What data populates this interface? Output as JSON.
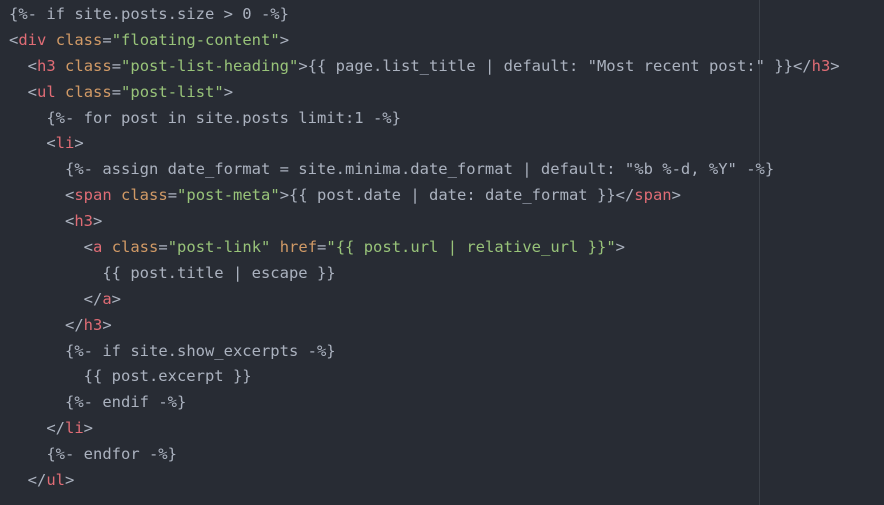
{
  "editor": {
    "colors": {
      "background": "#282c34",
      "plain": "#abb2bf",
      "tag": "#e06c75",
      "attribute": "#d19a66",
      "string": "#98c379",
      "ruler": "#3b4048"
    },
    "lines": [
      {
        "indent": 0,
        "tokens": [
          {
            "t": "plain",
            "v": "{%- if site.posts.size > 0 -%}"
          }
        ]
      },
      {
        "indent": 0,
        "tokens": [
          {
            "t": "plain",
            "v": "<"
          },
          {
            "t": "tag",
            "v": "div"
          },
          {
            "t": "plain",
            "v": " "
          },
          {
            "t": "attr",
            "v": "class"
          },
          {
            "t": "plain",
            "v": "="
          },
          {
            "t": "str",
            "v": "\"floating-content\""
          },
          {
            "t": "plain",
            "v": ">"
          }
        ]
      },
      {
        "indent": 2,
        "tokens": [
          {
            "t": "plain",
            "v": "<"
          },
          {
            "t": "tag",
            "v": "h3"
          },
          {
            "t": "plain",
            "v": " "
          },
          {
            "t": "attr",
            "v": "class"
          },
          {
            "t": "plain",
            "v": "="
          },
          {
            "t": "str",
            "v": "\"post-list-heading\""
          },
          {
            "t": "plain",
            "v": ">{{ page.list_title | default: \"Most recent post:\" }}</"
          },
          {
            "t": "tag",
            "v": "h3"
          },
          {
            "t": "plain",
            "v": ">"
          }
        ]
      },
      {
        "indent": 2,
        "tokens": [
          {
            "t": "plain",
            "v": "<"
          },
          {
            "t": "tag",
            "v": "ul"
          },
          {
            "t": "plain",
            "v": " "
          },
          {
            "t": "attr",
            "v": "class"
          },
          {
            "t": "plain",
            "v": "="
          },
          {
            "t": "str",
            "v": "\"post-list\""
          },
          {
            "t": "plain",
            "v": ">"
          }
        ]
      },
      {
        "indent": 4,
        "tokens": [
          {
            "t": "plain",
            "v": "{%- for post in site.posts limit:1 -%}"
          }
        ]
      },
      {
        "indent": 4,
        "tokens": [
          {
            "t": "plain",
            "v": "<"
          },
          {
            "t": "tag",
            "v": "li"
          },
          {
            "t": "plain",
            "v": ">"
          }
        ]
      },
      {
        "indent": 6,
        "tokens": [
          {
            "t": "plain",
            "v": "{%- assign date_format = site.minima.date_format | default: \"%b %-d, %Y\" -%}"
          }
        ]
      },
      {
        "indent": 6,
        "tokens": [
          {
            "t": "plain",
            "v": "<"
          },
          {
            "t": "tag",
            "v": "span"
          },
          {
            "t": "plain",
            "v": " "
          },
          {
            "t": "attr",
            "v": "class"
          },
          {
            "t": "plain",
            "v": "="
          },
          {
            "t": "str",
            "v": "\"post-meta\""
          },
          {
            "t": "plain",
            "v": ">{{ post.date | date: date_format }}</"
          },
          {
            "t": "tag",
            "v": "span"
          },
          {
            "t": "plain",
            "v": ">"
          }
        ]
      },
      {
        "indent": 6,
        "tokens": [
          {
            "t": "plain",
            "v": "<"
          },
          {
            "t": "tag",
            "v": "h3"
          },
          {
            "t": "plain",
            "v": ">"
          }
        ]
      },
      {
        "indent": 8,
        "tokens": [
          {
            "t": "plain",
            "v": "<"
          },
          {
            "t": "tag",
            "v": "a"
          },
          {
            "t": "plain",
            "v": " "
          },
          {
            "t": "attr",
            "v": "class"
          },
          {
            "t": "plain",
            "v": "="
          },
          {
            "t": "str",
            "v": "\"post-link\""
          },
          {
            "t": "plain",
            "v": " "
          },
          {
            "t": "attr",
            "v": "href"
          },
          {
            "t": "plain",
            "v": "="
          },
          {
            "t": "str",
            "v": "\"{{ post.url | relative_url }}\""
          },
          {
            "t": "plain",
            "v": ">"
          }
        ]
      },
      {
        "indent": 10,
        "tokens": [
          {
            "t": "plain",
            "v": "{{ post.title | escape }}"
          }
        ]
      },
      {
        "indent": 8,
        "tokens": [
          {
            "t": "plain",
            "v": "</"
          },
          {
            "t": "tag",
            "v": "a"
          },
          {
            "t": "plain",
            "v": ">"
          }
        ]
      },
      {
        "indent": 6,
        "tokens": [
          {
            "t": "plain",
            "v": "</"
          },
          {
            "t": "tag",
            "v": "h3"
          },
          {
            "t": "plain",
            "v": ">"
          }
        ]
      },
      {
        "indent": 6,
        "tokens": [
          {
            "t": "plain",
            "v": "{%- if site.show_excerpts -%}"
          }
        ]
      },
      {
        "indent": 8,
        "tokens": [
          {
            "t": "plain",
            "v": "{{ post.excerpt }}"
          }
        ]
      },
      {
        "indent": 6,
        "tokens": [
          {
            "t": "plain",
            "v": "{%- endif -%}"
          }
        ]
      },
      {
        "indent": 4,
        "tokens": [
          {
            "t": "plain",
            "v": "</"
          },
          {
            "t": "tag",
            "v": "li"
          },
          {
            "t": "plain",
            "v": ">"
          }
        ]
      },
      {
        "indent": 4,
        "tokens": [
          {
            "t": "plain",
            "v": "{%- endfor -%}"
          }
        ]
      },
      {
        "indent": 2,
        "tokens": [
          {
            "t": "plain",
            "v": "</"
          },
          {
            "t": "tag",
            "v": "ul"
          },
          {
            "t": "plain",
            "v": ">"
          }
        ]
      }
    ]
  }
}
